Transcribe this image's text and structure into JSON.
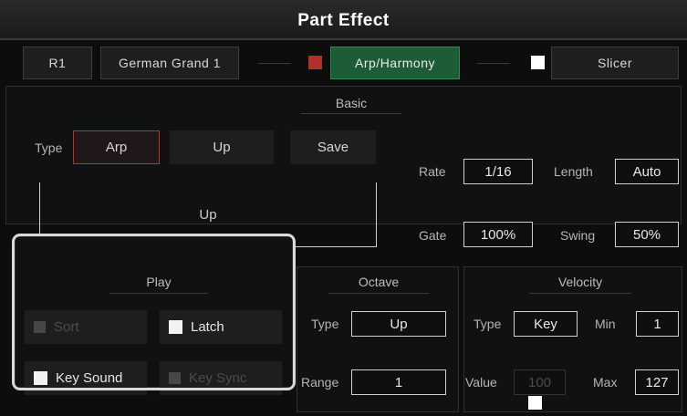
{
  "title": "Part Effect",
  "header": {
    "part": "R1",
    "voice": "German Grand 1",
    "arp_label": "Arp/Harmony",
    "slicer_label": "Slicer"
  },
  "colors": {
    "arp_indicator": "#c0302f",
    "slicer_indicator": "#ffffff",
    "active_green": "#1d5c37"
  },
  "basic": {
    "title": "Basic",
    "type_label": "Type",
    "type_value": "Arp",
    "style_value": "Up",
    "save_label": "Save",
    "display_text": "Up",
    "rate_label": "Rate",
    "rate_value": "1/16",
    "length_label": "Length",
    "length_value": "Auto",
    "gate_label": "Gate",
    "gate_value": "100%",
    "swing_label": "Swing",
    "swing_value": "50%"
  },
  "play": {
    "title": "Play",
    "sort_label": "Sort",
    "latch_label": "Latch",
    "key_sound_label": "Key Sound",
    "key_sync_label": "Key Sync"
  },
  "octave": {
    "title": "Octave",
    "type_label": "Type",
    "type_value": "Up",
    "range_label": "Range",
    "range_value": "1"
  },
  "velocity": {
    "title": "Velocity",
    "type_label": "Type",
    "type_value": "Key",
    "min_label": "Min",
    "min_value": "1",
    "value_label": "Value",
    "value_value": "100",
    "max_label": "Max",
    "max_value": "127"
  }
}
